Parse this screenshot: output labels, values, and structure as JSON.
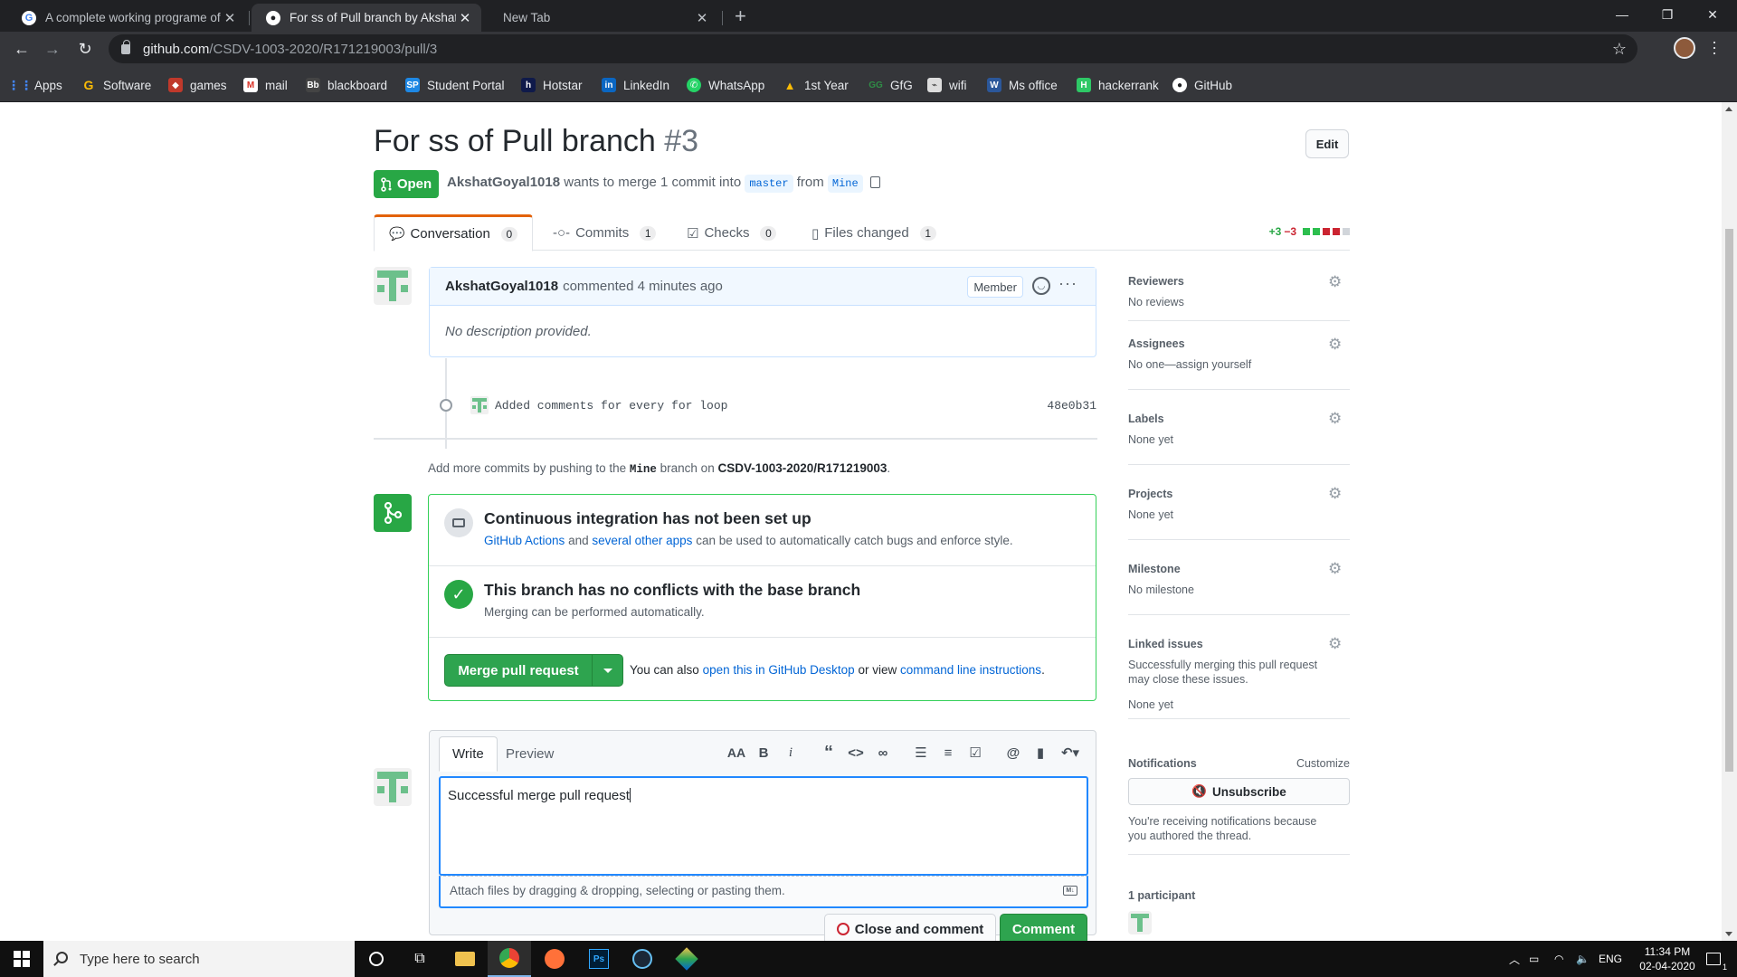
{
  "browser": {
    "tabs": [
      {
        "title": "A complete working programe of",
        "favicon": "google-icon",
        "active": false
      },
      {
        "title": "For ss of Pull branch by AkshatGo",
        "favicon": "github-icon",
        "active": true
      },
      {
        "title": "New Tab",
        "favicon": "",
        "active": false
      }
    ],
    "url_host": "github.com",
    "url_path": "/CSDV-1003-2020/R171219003/pull/3",
    "bookmarks": [
      {
        "label": "Apps",
        "icon": "apps-grid-icon",
        "color": "#4285f4"
      },
      {
        "label": "Software",
        "icon": "g-icon",
        "color": "#fbbc05"
      },
      {
        "label": "games",
        "icon": "gamepad-icon",
        "color": "#c0392b"
      },
      {
        "label": "mail",
        "icon": "gmail-icon",
        "color": "#d93025"
      },
      {
        "label": "blackboard",
        "icon": "blackboard-icon",
        "color": "#444444"
      },
      {
        "label": "Student Portal",
        "icon": "sp-icon",
        "color": "#1e88e5"
      },
      {
        "label": "Hotstar",
        "icon": "hotstar-icon",
        "color": "#0f1a4a"
      },
      {
        "label": "LinkedIn",
        "icon": "linkedin-icon",
        "color": "#0a66c2"
      },
      {
        "label": "WhatsApp",
        "icon": "whatsapp-icon",
        "color": "#25d366"
      },
      {
        "label": "1st Year",
        "icon": "drive-icon",
        "color": "#fbbc05"
      },
      {
        "label": "GfG",
        "icon": "gfg-icon",
        "color": "#2f8d46"
      },
      {
        "label": "wifi",
        "icon": "wifi-bookmark-icon",
        "color": "#dddddd"
      },
      {
        "label": "Ms office",
        "icon": "office-icon",
        "color": "#2b579a"
      },
      {
        "label": "hackerrank",
        "icon": "hackerrank-icon",
        "color": "#2ec866"
      },
      {
        "label": "GitHub",
        "icon": "github-icon",
        "color": "#ffffff"
      }
    ]
  },
  "pr": {
    "title": "For ss of Pull branch",
    "number": "#3",
    "edit_label": "Edit",
    "state": "Open",
    "author": "AkshatGoyal1018",
    "meta_mid": "wants to merge 1 commit into",
    "base_branch": "master",
    "meta_from": "from",
    "head_branch": "Mine",
    "tabs": [
      {
        "label": "Conversation",
        "count": "0",
        "icon": "comment-discussion-icon"
      },
      {
        "label": "Commits",
        "count": "1",
        "icon": "git-commit-icon"
      },
      {
        "label": "Checks",
        "count": "0",
        "icon": "checklist-icon"
      },
      {
        "label": "Files changed",
        "count": "1",
        "icon": "file-diff-icon"
      }
    ],
    "diffstat_add": "+3",
    "diffstat_del": "−3"
  },
  "comment": {
    "author": "AkshatGoyal1018",
    "action": "commented 4 minutes ago",
    "role_badge": "Member",
    "body": "No description provided."
  },
  "commit": {
    "message": "Added comments for every for loop",
    "sha": "48e0b31"
  },
  "push_hint": {
    "prefix": "Add more commits by pushing to the",
    "branch": "Mine",
    "mid": "branch on",
    "repo": "CSDV-1003-2020/R171219003",
    "suffix": "."
  },
  "merge": {
    "ci_title": "Continuous integration has not been set up",
    "ci_link1": "GitHub Actions",
    "ci_and": "and",
    "ci_link2": "several other apps",
    "ci_rest": "can be used to automatically catch bugs and enforce style.",
    "conflict_title": "This branch has no conflicts with the base branch",
    "conflict_sub": "Merging can be performed automatically.",
    "button": "Merge pull request",
    "note_prefix": "You can also",
    "note_link1": "open this in GitHub Desktop",
    "note_mid": "or view",
    "note_link2": "command line instructions",
    "note_suffix": "."
  },
  "composer": {
    "tab_write": "Write",
    "tab_preview": "Preview",
    "text": "Successful merge pull request",
    "attach_hint": "Attach files by dragging & dropping, selecting or pasting them.",
    "close_button": "Close and comment",
    "comment_button": "Comment"
  },
  "sidebar": {
    "reviewers": {
      "heading": "Reviewers",
      "value": "No reviews"
    },
    "assignees": {
      "heading": "Assignees",
      "value": "No one—assign yourself"
    },
    "labels": {
      "heading": "Labels",
      "value": "None yet"
    },
    "projects": {
      "heading": "Projects",
      "value": "None yet"
    },
    "milestone": {
      "heading": "Milestone",
      "value": "No milestone"
    },
    "linked": {
      "heading": "Linked issues",
      "desc1": "Successfully merging this pull request",
      "desc2": "may close these issues.",
      "value": "None yet"
    },
    "notifications": {
      "heading": "Notifications",
      "customize": "Customize",
      "button": "Unsubscribe",
      "desc1": "You're receiving notifications because",
      "desc2": "you authored the thread."
    },
    "participants": {
      "heading": "1 participant"
    }
  },
  "taskbar": {
    "search_placeholder": "Type here to search",
    "lang": "ENG",
    "time": "11:34 PM",
    "date": "02-04-2020",
    "notif_count": "1"
  },
  "colors": {
    "open_green": "#28a745",
    "link_blue": "#0366d6",
    "chrome_dark": "#35363a"
  }
}
